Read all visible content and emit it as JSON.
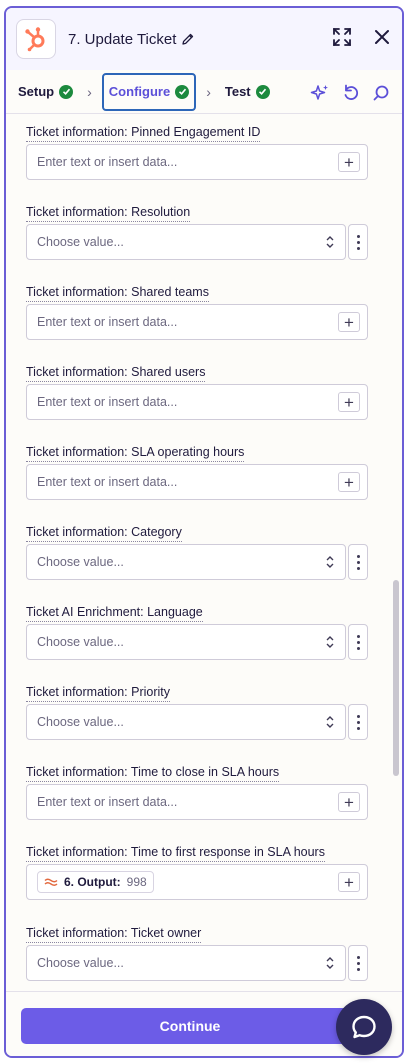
{
  "header": {
    "title": "7. Update Ticket",
    "icons": [
      "hubspot-logo",
      "pencil-icon",
      "expand-icon",
      "close-icon"
    ]
  },
  "tabs": [
    {
      "label": "Setup",
      "status": "complete"
    },
    {
      "label": "Configure",
      "status": "complete",
      "active": true
    },
    {
      "label": "Test",
      "status": "complete"
    }
  ],
  "tab_tools": [
    "sparkle-icon",
    "undo-icon",
    "search-icon"
  ],
  "fields": [
    {
      "label": "Ticket information: Pinned Engagement ID",
      "type": "text",
      "placeholder": "Enter text or insert data..."
    },
    {
      "label": "Ticket information: Resolution",
      "type": "select",
      "placeholder": "Choose value..."
    },
    {
      "label": "Ticket information: Shared teams",
      "type": "text",
      "placeholder": "Enter text or insert data..."
    },
    {
      "label": "Ticket information: Shared users",
      "type": "text",
      "placeholder": "Enter text or insert data..."
    },
    {
      "label": "Ticket information: SLA operating hours",
      "type": "text",
      "placeholder": "Enter text or insert data..."
    },
    {
      "label": "Ticket information: Category",
      "type": "select",
      "placeholder": "Choose value..."
    },
    {
      "label": "Ticket AI Enrichment: Language",
      "type": "select",
      "placeholder": "Choose value..."
    },
    {
      "label": "Ticket information: Priority",
      "type": "select",
      "placeholder": "Choose value..."
    },
    {
      "label": "Ticket information: Time to close in SLA hours",
      "type": "text",
      "placeholder": "Enter text or insert data..."
    },
    {
      "label": "Ticket information: Time to first response in SLA hours",
      "type": "pill",
      "pill_name": "6. Output:",
      "pill_value": "998"
    },
    {
      "label": "Ticket information: Ticket owner",
      "type": "select",
      "placeholder": "Choose value..."
    }
  ],
  "footer": {
    "continue_label": "Continue"
  },
  "colors": {
    "accent": "#6c5ce7",
    "check": "#1c8a3e",
    "hubspot": "#ff7a59"
  }
}
